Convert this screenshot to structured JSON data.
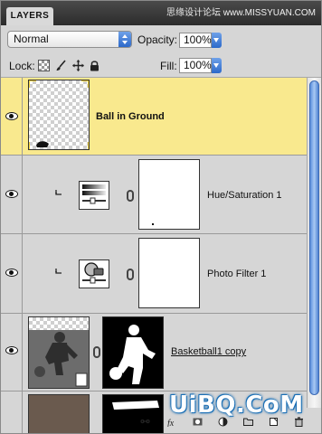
{
  "panel": {
    "tab_label": "LAYERS",
    "watermark_cn": "思缘设计论坛",
    "watermark_site": "www.MISSYUAN.COM"
  },
  "blend": {
    "mode": "Normal",
    "opacity_label": "Opacity:",
    "opacity_value": "100%"
  },
  "lock": {
    "label": "Lock:",
    "fill_label": "Fill:",
    "fill_value": "100%"
  },
  "layers": [
    {
      "name": "Ball in Ground",
      "selected": true,
      "visible": true
    },
    {
      "name": "Hue/Saturation 1",
      "selected": false,
      "visible": true,
      "clipped": true
    },
    {
      "name": "Photo Filter 1",
      "selected": false,
      "visible": true,
      "clipped": true
    },
    {
      "name": "Basketball1 copy",
      "selected": false,
      "visible": true
    }
  ],
  "bottom": {
    "brand": "UiBQ.CoM"
  },
  "colors": {
    "selected_row": "#f9e98e",
    "accent_blue": "#2c69c9",
    "tab_bar": "#3a3a3a"
  }
}
